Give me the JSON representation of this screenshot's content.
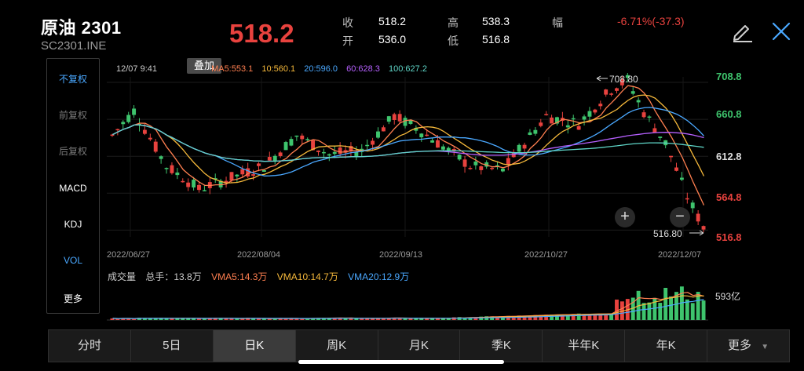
{
  "header": {
    "title": "原油 2301",
    "code": "SC2301.INE",
    "price": "518.2",
    "quotes": [
      {
        "label": "收",
        "value": "518.2"
      },
      {
        "label": "开",
        "value": "536.0"
      },
      {
        "label": "高",
        "value": "538.3"
      },
      {
        "label": "低",
        "value": "516.8"
      }
    ],
    "change_label": "幅",
    "change": "-6.71%(-37.3)",
    "icons": {
      "edit": "pencil-icon",
      "close": "close-icon"
    }
  },
  "left_panel": {
    "items": [
      "不复权",
      "前复权",
      "后复权",
      "MACD",
      "KDJ",
      "VOL",
      "更多"
    ]
  },
  "chart": {
    "overlay_tag": "叠加",
    "date_time": "12/07 9:41",
    "ma_legend": [
      {
        "label": "MA5:553.1",
        "color": "#ff7f50"
      },
      {
        "label": "10:560.1",
        "color": "#f6b93b"
      },
      {
        "label": "20:596.0",
        "color": "#4aa8ff"
      },
      {
        "label": "60:628.3",
        "color": "#b660ff"
      },
      {
        "label": "100:627.2",
        "color": "#5fd6c8"
      }
    ],
    "y_ticks": [
      {
        "value": "708.8",
        "color": "#3ec46d"
      },
      {
        "value": "660.8",
        "color": "#3ec46d"
      },
      {
        "value": "612.8",
        "color": "#dddddd"
      },
      {
        "value": "564.8",
        "color": "#e8423e"
      },
      {
        "value": "516.8",
        "color": "#e8423e"
      }
    ],
    "x_ticks": [
      "2022/06/27",
      "2022/08/04",
      "2022/09/13",
      "2022/10/27",
      "2022/12/07"
    ],
    "high_annotation": "708.80",
    "low_annotation": "516.80",
    "zoom_in": "+",
    "zoom_out": "−"
  },
  "volume": {
    "label": "成交量",
    "total": "总手：13.8万",
    "vma": [
      {
        "label": "VMA5:14.3万",
        "color": "#ff7f50"
      },
      {
        "label": "VMA10:14.7万",
        "color": "#f6b93b"
      },
      {
        "label": "VMA20:12.9万",
        "color": "#4aa8ff"
      }
    ],
    "axis_max": "593亿"
  },
  "tabs": {
    "items": [
      "分时",
      "5日",
      "日K",
      "周K",
      "月K",
      "季K",
      "半年K",
      "年K",
      "更多"
    ],
    "active": "日K"
  },
  "colors": {
    "up": "#e8423e",
    "down": "#3ec46d",
    "background": "#000000"
  }
}
